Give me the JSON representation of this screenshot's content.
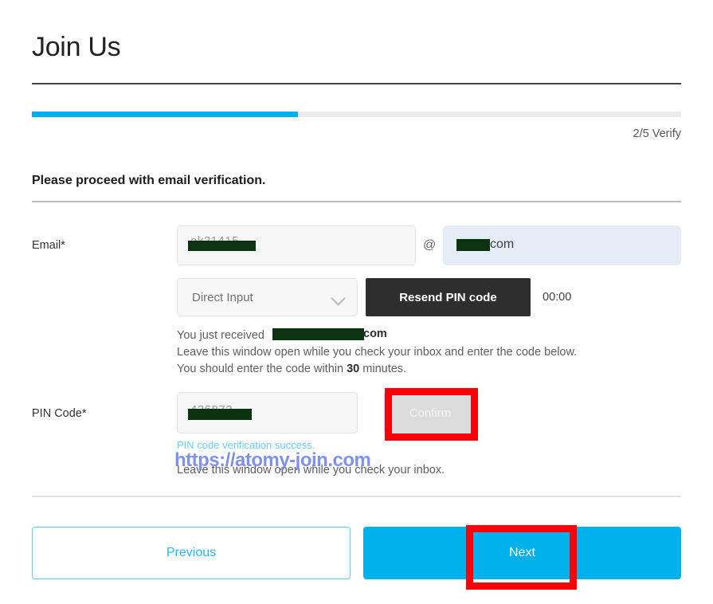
{
  "header": {
    "title": "Join Us"
  },
  "progress": {
    "percent": 41,
    "step_label": "2/5 Verify"
  },
  "intro": {
    "text": "Please proceed with email verification."
  },
  "form": {
    "email": {
      "label": "Email*",
      "local_value": "ek21415",
      "at_separator": "@",
      "domain_value": "com",
      "redacted": true
    },
    "provider_select": {
      "selected": "Direct Input",
      "chevron_icon": "chevron-down-icon"
    },
    "resend": {
      "label": "Resend PIN code",
      "timer": "00:00"
    },
    "helper": {
      "line1_prefix": "You just received ",
      "line1_suffix": "com",
      "line2": "Leave this window open while you check your inbox and enter the code below.",
      "line3_prefix": "You should enter the code within ",
      "line3_bold": "30",
      "line3_suffix": " minutes.",
      "line4": "Leave this window open while you check your inbox."
    },
    "pin": {
      "label": "PIN Code*",
      "value": "436872",
      "confirm_label": "Confirm",
      "success_message": "PIN code verification success."
    }
  },
  "footer": {
    "previous_label": "Previous",
    "next_label": "Next"
  },
  "watermark": {
    "text": "https://atomy-join.com"
  },
  "colors": {
    "accent_cyan": "#00b0ea",
    "progress_fill": "#00b0ed",
    "resend_button": "#2e2e2e",
    "annotation_red": "#fb0007",
    "redaction": "#0b3312",
    "success_text": "#6fc9f2",
    "watermark": "#7b8ce8"
  }
}
